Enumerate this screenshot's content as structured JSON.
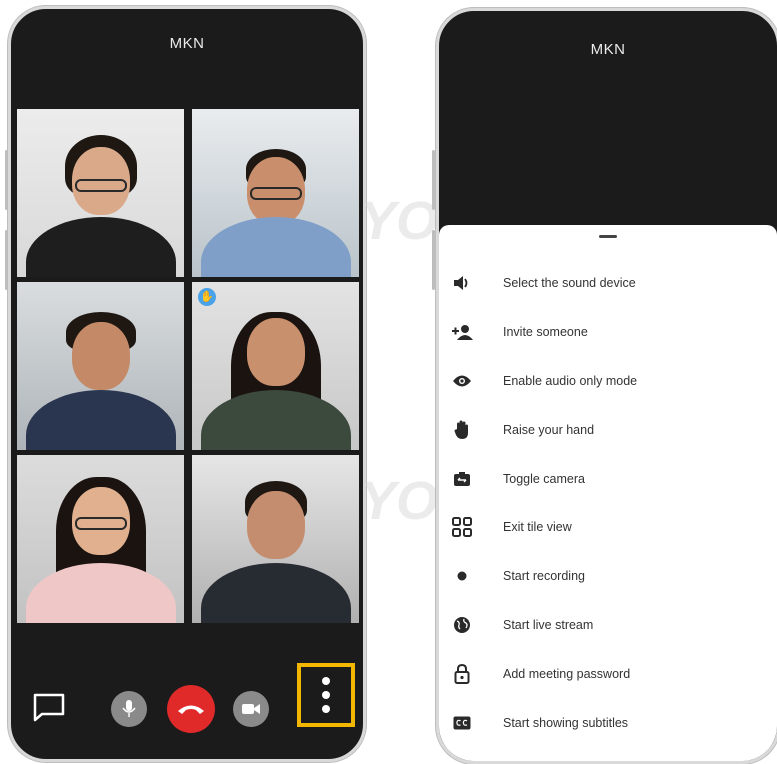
{
  "left_phone": {
    "title": "MKN",
    "toolbar": {
      "chat_icon": "chat-icon",
      "mic_icon": "microphone-icon",
      "hangup_icon": "hangup-icon",
      "camera_icon": "camera-icon",
      "more_icon": "more-vertical-icon",
      "highlight_color": "#f3b700"
    }
  },
  "right_phone": {
    "title": "MKN",
    "menu": [
      {
        "label": "Select the sound device",
        "icon": "speaker-icon"
      },
      {
        "label": "Invite someone",
        "icon": "add-person-icon"
      },
      {
        "label": "Enable audio only mode",
        "icon": "eye-icon"
      },
      {
        "label": "Raise your hand",
        "icon": "hand-icon"
      },
      {
        "label": "Toggle camera",
        "icon": "switch-camera-icon"
      },
      {
        "label": "Exit tile view",
        "icon": "grid-icon"
      },
      {
        "label": "Start recording",
        "icon": "record-icon"
      },
      {
        "label": "Start live stream",
        "icon": "globe-icon"
      },
      {
        "label": "Add meeting password",
        "icon": "lock-icon"
      },
      {
        "label": "Start showing subtitles",
        "icon": "closed-captions-icon"
      }
    ]
  },
  "colors": {
    "hangup": "#e02a2a",
    "phone_background": "#1b1b1b"
  }
}
